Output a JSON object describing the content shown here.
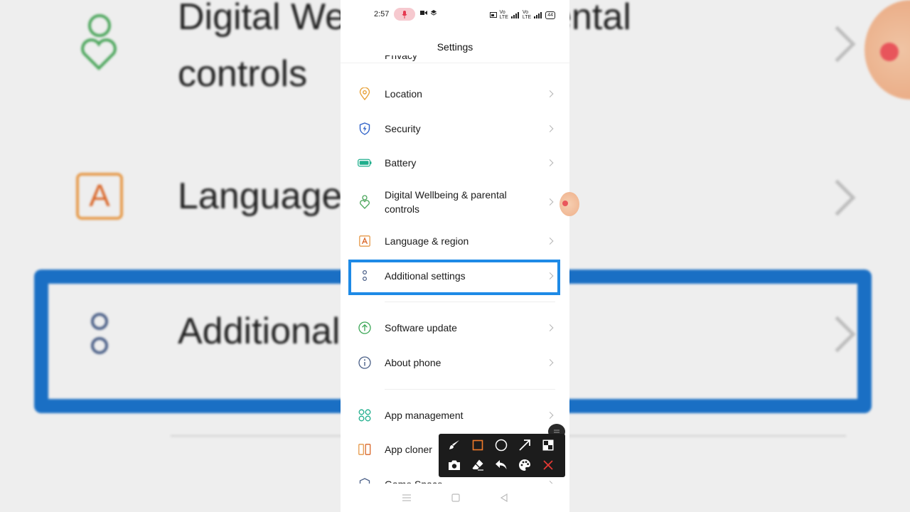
{
  "background": {
    "line1": "Digital Wellbeing & parental",
    "line2": "controls",
    "line3": "Language & region",
    "line4": "Additional settings"
  },
  "status_bar": {
    "time": "2:57",
    "battery": "44"
  },
  "app_bar": {
    "title": "Settings"
  },
  "settings": {
    "partial_top_label": "Privacy",
    "items": [
      {
        "label": "Location",
        "icon": "location-pin-icon",
        "color": "#e8a23a"
      },
      {
        "label": "Security",
        "icon": "shield-bolt-icon",
        "color": "#2f62c9"
      },
      {
        "label": "Battery",
        "icon": "battery-icon",
        "color": "#1fae8c"
      },
      {
        "label": "Digital Wellbeing & parental controls",
        "icon": "wellbeing-heart-icon",
        "color": "#4aa55a"
      },
      {
        "label": "Language & region",
        "icon": "language-a-icon",
        "color": "#e69a4a"
      },
      {
        "label": "Additional settings",
        "icon": "dots-icon",
        "color": "#4a5f87"
      },
      {
        "label": "Software update",
        "icon": "update-arrow-icon",
        "color": "#3aa655"
      },
      {
        "label": "About phone",
        "icon": "info-icon",
        "color": "#4a5f87"
      },
      {
        "label": "App management",
        "icon": "app-grid-icon",
        "color": "#1fae8c"
      },
      {
        "label": "App cloner",
        "icon": "app-cloner-icon",
        "color": "#e69a4a"
      },
      {
        "label": "Game Space",
        "icon": "game-space-icon",
        "color": "#4a5f87"
      }
    ]
  },
  "colors": {
    "highlight": "#1e8ae6",
    "toolbox_bg": "#1c1c1c",
    "rectangle_tool": "#f07a2a",
    "close_tool": "#e53935"
  },
  "toolbox": {
    "tools": [
      "brush-tool",
      "rectangle-tool",
      "circle-tool",
      "arrow-tool",
      "mosaic-tool",
      "screenshot-tool",
      "eraser-tool",
      "undo-tool",
      "palette-tool",
      "close-tool"
    ]
  }
}
